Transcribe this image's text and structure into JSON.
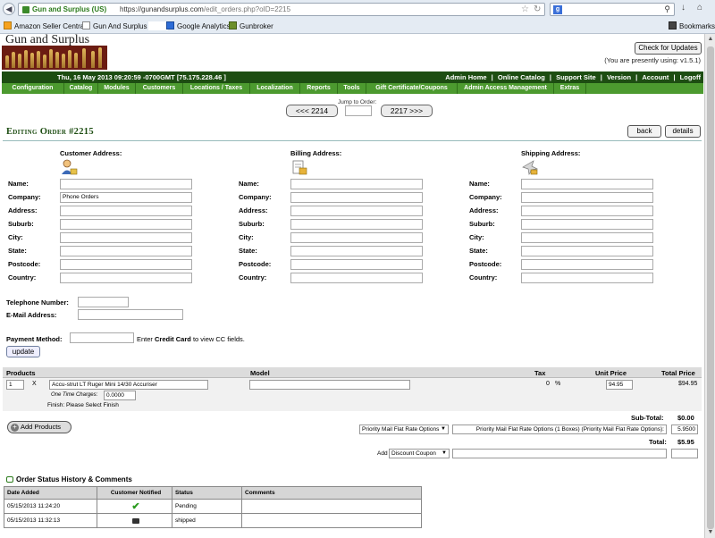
{
  "browser": {
    "site_identity": "Gun and Surplus (US)",
    "url_host": "https://gunandsurplus.com",
    "url_path": "/edit_orders.php?oID=2215",
    "bookmarks": [
      "Amazon Seller Central",
      "Gun And Surplus",
      "Google Analytics",
      "Gunbroker"
    ],
    "bookmarks_menu": "Bookmarks"
  },
  "header": {
    "store_name": "Gun and Surplus",
    "check_updates": "Check for Updates",
    "version_note": "(You are presently using: v1.5.1)",
    "datetime": "Thu, 16 May 2013 09:20:59 -0700GMT [75.175.228.46 ]",
    "top_links": [
      "Admin Home",
      "Online Catalog",
      "Support Site",
      "Version",
      "Account",
      "Logoff"
    ],
    "top_sep": "|",
    "menu": [
      "Configuration",
      "Catalog",
      "Modules",
      "Customers",
      "Locations / Taxes",
      "Localization",
      "Reports",
      "Tools",
      "Gift Certificate/Coupons",
      "Admin Access Management",
      "Extras"
    ]
  },
  "nav": {
    "prev": "<<< 2214",
    "next": "2217 >>>",
    "jump_label": "Jump to Order:"
  },
  "order": {
    "title": "Editing Order #2215",
    "back": "back",
    "details": "details"
  },
  "addresses": {
    "customer_heading": "Customer Address:",
    "billing_heading": "Billing Address:",
    "shipping_heading": "Shipping Address:",
    "labels": [
      "Name:",
      "Company:",
      "Address:",
      "Suburb:",
      "City:",
      "State:",
      "Postcode:",
      "Country:"
    ],
    "customer_company": "Phone Orders"
  },
  "contact": {
    "telephone_label": "Telephone Number:",
    "email_label": "E-Mail Address:",
    "payment_label": "Payment Method:",
    "cc_prefix": "Enter ",
    "cc_bold": "Credit Card",
    "cc_suffix": " to view CC fields.",
    "update": "update"
  },
  "products": {
    "headers": {
      "products": "Products",
      "model": "Model",
      "tax": "Tax",
      "unit_price": "Unit Price",
      "total_price": "Total Price"
    },
    "qty": "1",
    "x": "X",
    "name": "Accu-strut LT Ruger Mini 14/30 Accuriser",
    "tax": "0",
    "percent": "%",
    "unit_price": "94.95",
    "total_price": "$94.95",
    "one_time_label": "One Time Charges:",
    "one_time_value": "0.0000",
    "finish": "Finish: Please Select Finish"
  },
  "totals": {
    "add_products": "Add Products",
    "shipping_select": "Priority Mail Flat Rate Options",
    "shipping_text": "Priority Mail Flat Rate Options (1 Boxes) (Priority Mail Flat Rate Options):",
    "shipping_value": "5.9500",
    "subtotal_label": "Sub-Total:",
    "subtotal_value": "$0.00",
    "total_label": "Total:",
    "total_value": "$5.95",
    "add_label": "Add",
    "discount_select": "Discount Coupon"
  },
  "history": {
    "title": "Order Status History & Comments",
    "columns": [
      "Date Added",
      "Customer Notified",
      "Status",
      "Comments"
    ],
    "rows": [
      {
        "date": "05/15/2013 11:24:20",
        "status": "Pending",
        "comments": ""
      },
      {
        "date": "05/15/2013 11:32:13",
        "status": "shipped",
        "comments": ""
      }
    ]
  }
}
